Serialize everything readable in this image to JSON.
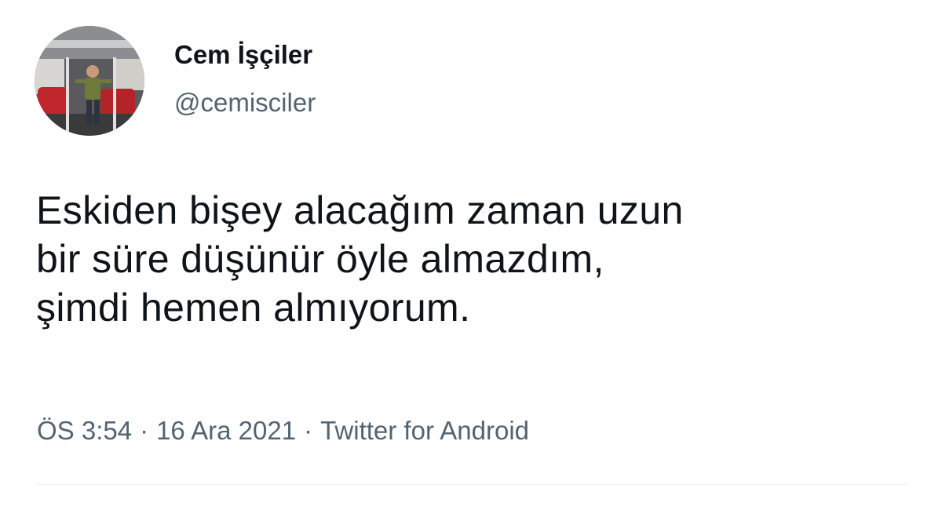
{
  "tweet": {
    "author": {
      "display_name": "Cem İşçiler",
      "handle": "@cemisciler",
      "avatar_icon": "profile-photo"
    },
    "text_lines": [
      "Eskiden bişey alacağım zaman uzun",
      "bir süre düşünür öyle almazdım,",
      "şimdi hemen almıyorum."
    ],
    "meta": {
      "time": "ÖS 3:54",
      "separator": "·",
      "date": "16 Ara 2021",
      "source": "Twitter for Android"
    }
  },
  "colors": {
    "text_primary": "#0f1419",
    "text_secondary": "#536471",
    "divider": "#eff3f4",
    "background": "#ffffff"
  }
}
